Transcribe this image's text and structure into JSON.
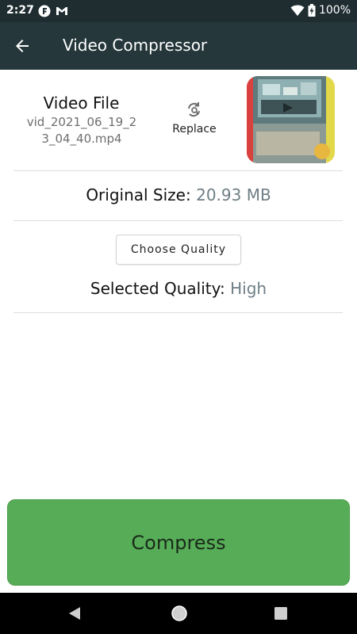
{
  "status_bar": {
    "time": "2:27",
    "battery": "100%",
    "icons": [
      "notification-f-icon",
      "gmail-icon",
      "wifi-icon",
      "battery-icon"
    ]
  },
  "app_bar": {
    "title": "Video Compressor",
    "back_icon": "arrow-left-icon",
    "background": "#25373b"
  },
  "file": {
    "title": "Video File",
    "name_line1": "vid_2021_06_19_2",
    "name_line2": "3_04_40.mp4",
    "replace_label": "Replace",
    "replace_icon": "refresh-search-icon"
  },
  "original_size": {
    "label": "Original Size:",
    "value": "20.93 MB"
  },
  "quality": {
    "choose_label": "Choose Quality",
    "selected_label": "Selected Quality:",
    "selected_value": "High"
  },
  "compress": {
    "label": "Compress",
    "color": "#57ad57"
  },
  "nav_bar": {
    "icons": [
      "nav-back-icon",
      "nav-home-icon",
      "nav-recents-icon"
    ]
  }
}
